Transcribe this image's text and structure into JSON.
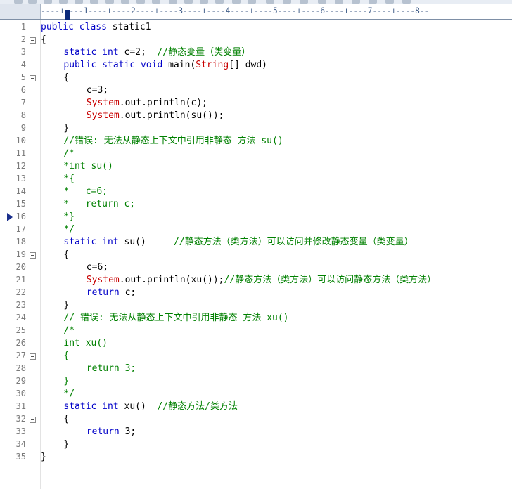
{
  "ruler": {
    "text": "----+----1----+----2----+----3----+----4----+----5----+----6----+----7----+----8--"
  },
  "editor": {
    "active_line": 16,
    "lines": [
      {
        "n": "1",
        "indent": 0,
        "fold": false,
        "tokens": [
          [
            "kw",
            "public class"
          ],
          [
            "nm",
            " static1"
          ]
        ]
      },
      {
        "n": "2",
        "indent": 0,
        "fold": true,
        "tokens": [
          [
            "nm",
            "{"
          ]
        ]
      },
      {
        "n": "3",
        "indent": 4,
        "fold": false,
        "tokens": [
          [
            "kw",
            "static int"
          ],
          [
            "nm",
            " c=2;  "
          ],
          [
            "cm",
            "//静态变量（类变量）"
          ]
        ]
      },
      {
        "n": "4",
        "indent": 4,
        "fold": false,
        "tokens": [
          [
            "kw",
            "public static void"
          ],
          [
            "nm",
            " main("
          ],
          [
            "tp",
            "String"
          ],
          [
            "nm",
            "[] dwd)"
          ]
        ]
      },
      {
        "n": "5",
        "indent": 4,
        "fold": true,
        "tokens": [
          [
            "nm",
            "{"
          ]
        ]
      },
      {
        "n": "6",
        "indent": 8,
        "fold": false,
        "tokens": [
          [
            "nm",
            "c=3;"
          ]
        ]
      },
      {
        "n": "7",
        "indent": 8,
        "fold": false,
        "tokens": [
          [
            "tp",
            "System"
          ],
          [
            "nm",
            ".out.println(c);"
          ]
        ]
      },
      {
        "n": "8",
        "indent": 8,
        "fold": false,
        "tokens": [
          [
            "tp",
            "System"
          ],
          [
            "nm",
            ".out.println(su());"
          ]
        ]
      },
      {
        "n": "9",
        "indent": 4,
        "fold": false,
        "tokens": [
          [
            "nm",
            "}"
          ]
        ]
      },
      {
        "n": "10",
        "indent": 4,
        "fold": false,
        "tokens": [
          [
            "cm",
            "//错误: 无法从静态上下文中引用非静态 方法 su()"
          ]
        ]
      },
      {
        "n": "11",
        "indent": 4,
        "fold": false,
        "tokens": [
          [
            "cm",
            "/*"
          ]
        ]
      },
      {
        "n": "12",
        "indent": 4,
        "fold": false,
        "tokens": [
          [
            "cm",
            "*int su()"
          ]
        ]
      },
      {
        "n": "13",
        "indent": 4,
        "fold": false,
        "tokens": [
          [
            "cm",
            "*{"
          ]
        ]
      },
      {
        "n": "14",
        "indent": 4,
        "fold": false,
        "tokens": [
          [
            "cm",
            "*   c=6;"
          ]
        ]
      },
      {
        "n": "15",
        "indent": 4,
        "fold": false,
        "tokens": [
          [
            "cm",
            "*   return c;"
          ]
        ]
      },
      {
        "n": "16",
        "indent": 4,
        "fold": false,
        "tokens": [
          [
            "cm",
            "*}"
          ]
        ]
      },
      {
        "n": "17",
        "indent": 4,
        "fold": false,
        "tokens": [
          [
            "cm",
            "*/"
          ]
        ]
      },
      {
        "n": "18",
        "indent": 4,
        "fold": false,
        "tokens": [
          [
            "kw",
            "static int"
          ],
          [
            "nm",
            " su()     "
          ],
          [
            "cm",
            "//静态方法（类方法）可以访问并修改静态变量（类变量）"
          ]
        ]
      },
      {
        "n": "19",
        "indent": 4,
        "fold": true,
        "tokens": [
          [
            "nm",
            "{"
          ]
        ]
      },
      {
        "n": "20",
        "indent": 8,
        "fold": false,
        "tokens": [
          [
            "nm",
            "c=6;"
          ]
        ]
      },
      {
        "n": "21",
        "indent": 8,
        "fold": false,
        "tokens": [
          [
            "tp",
            "System"
          ],
          [
            "nm",
            ".out.println(xu());"
          ],
          [
            "cm",
            "//静态方法（类方法）可以访问静态方法（类方法）"
          ]
        ]
      },
      {
        "n": "22",
        "indent": 8,
        "fold": false,
        "tokens": [
          [
            "kw",
            "return"
          ],
          [
            "nm",
            " c;"
          ]
        ]
      },
      {
        "n": "23",
        "indent": 4,
        "fold": false,
        "tokens": [
          [
            "nm",
            "}"
          ]
        ]
      },
      {
        "n": "24",
        "indent": 4,
        "fold": false,
        "tokens": [
          [
            "cm",
            "// 错误: 无法从静态上下文中引用非静态 方法 xu()"
          ]
        ]
      },
      {
        "n": "25",
        "indent": 4,
        "fold": false,
        "tokens": [
          [
            "cm",
            "/*"
          ]
        ]
      },
      {
        "n": "26",
        "indent": 4,
        "fold": false,
        "tokens": [
          [
            "cm",
            "int xu()"
          ]
        ]
      },
      {
        "n": "27",
        "indent": 4,
        "fold": true,
        "tokens": [
          [
            "cm",
            "{"
          ]
        ]
      },
      {
        "n": "28",
        "indent": 8,
        "fold": false,
        "tokens": [
          [
            "cm",
            "return 3;"
          ]
        ]
      },
      {
        "n": "29",
        "indent": 4,
        "fold": false,
        "tokens": [
          [
            "cm",
            "}"
          ]
        ]
      },
      {
        "n": "30",
        "indent": 4,
        "fold": false,
        "tokens": [
          [
            "cm",
            "*/"
          ]
        ]
      },
      {
        "n": "31",
        "indent": 4,
        "fold": false,
        "tokens": [
          [
            "kw",
            "static int"
          ],
          [
            "nm",
            " xu()  "
          ],
          [
            "cm",
            "//静态方法/类方法"
          ]
        ]
      },
      {
        "n": "32",
        "indent": 4,
        "fold": true,
        "tokens": [
          [
            "nm",
            "{"
          ]
        ]
      },
      {
        "n": "33",
        "indent": 8,
        "fold": false,
        "tokens": [
          [
            "kw",
            "return"
          ],
          [
            "nm",
            " 3;"
          ]
        ]
      },
      {
        "n": "34",
        "indent": 4,
        "fold": false,
        "tokens": [
          [
            "nm",
            "}"
          ]
        ]
      },
      {
        "n": "35",
        "indent": 0,
        "fold": false,
        "tokens": [
          [
            "nm",
            "}"
          ]
        ]
      }
    ]
  }
}
